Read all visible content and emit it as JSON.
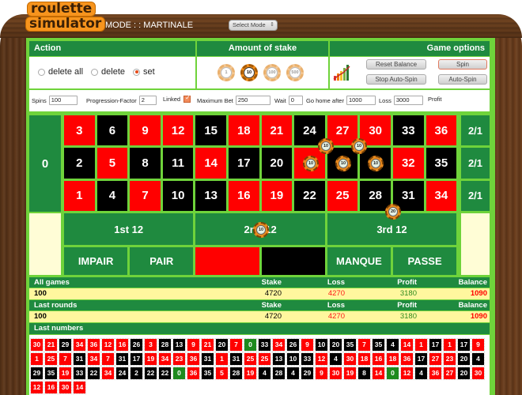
{
  "app": {
    "logo_line1": "roulette",
    "logo_line2": "simulator",
    "mode_label": "MODE : : MARTINALE",
    "mode_select": "Select Mode"
  },
  "action": {
    "header": "Action",
    "options": [
      {
        "label": "delete all",
        "selected": false
      },
      {
        "label": "delete",
        "selected": false
      },
      {
        "label": "set",
        "selected": true
      }
    ]
  },
  "stake": {
    "header": "Amount of stake",
    "chips": [
      {
        "value": "1",
        "selected": false
      },
      {
        "value": "10",
        "selected": true
      },
      {
        "value": "100",
        "selected": false
      },
      {
        "value": "500",
        "selected": false
      }
    ]
  },
  "game_options": {
    "header": "Game options",
    "icon": "growth-chart-icon",
    "buttons": {
      "reset_balance": "Reset Balance",
      "spin": "Spin",
      "stop_auto_spin": "Stop Auto-Spin",
      "auto_spin": "Auto-Spin"
    }
  },
  "params": {
    "spins_label": "Spins",
    "spins_value": "100",
    "factor_label": "Progression-Factor",
    "factor_value": "2",
    "linked_label": "Linked",
    "linked_checked": true,
    "maxbet_label": "Maximum Bet",
    "maxbet_value": "250",
    "wait_label": "Wait",
    "wait_value": "0",
    "gohome_label": "Go home after",
    "gohome_value": "1000",
    "loss_label": "Loss",
    "loss_value": "3000",
    "profit_label": "Profit"
  },
  "table": {
    "zero": "0",
    "rows": [
      [
        {
          "n": "3",
          "c": "red"
        },
        {
          "n": "6",
          "c": "black"
        },
        {
          "n": "9",
          "c": "red"
        },
        {
          "n": "12",
          "c": "red"
        },
        {
          "n": "15",
          "c": "black"
        },
        {
          "n": "18",
          "c": "red"
        },
        {
          "n": "21",
          "c": "red"
        },
        {
          "n": "24",
          "c": "black"
        },
        {
          "n": "27",
          "c": "red"
        },
        {
          "n": "30",
          "c": "red"
        },
        {
          "n": "33",
          "c": "black"
        },
        {
          "n": "36",
          "c": "red"
        }
      ],
      [
        {
          "n": "2",
          "c": "black"
        },
        {
          "n": "5",
          "c": "red"
        },
        {
          "n": "8",
          "c": "black"
        },
        {
          "n": "11",
          "c": "black"
        },
        {
          "n": "14",
          "c": "red"
        },
        {
          "n": "17",
          "c": "black"
        },
        {
          "n": "20",
          "c": "black"
        },
        {
          "n": "23",
          "c": "red"
        },
        {
          "n": "26",
          "c": "black"
        },
        {
          "n": "29",
          "c": "black"
        },
        {
          "n": "32",
          "c": "red"
        },
        {
          "n": "35",
          "c": "black"
        }
      ],
      [
        {
          "n": "1",
          "c": "red"
        },
        {
          "n": "4",
          "c": "black"
        },
        {
          "n": "7",
          "c": "red"
        },
        {
          "n": "10",
          "c": "black"
        },
        {
          "n": "13",
          "c": "black"
        },
        {
          "n": "16",
          "c": "red"
        },
        {
          "n": "19",
          "c": "red"
        },
        {
          "n": "22",
          "c": "black"
        },
        {
          "n": "25",
          "c": "red"
        },
        {
          "n": "28",
          "c": "black"
        },
        {
          "n": "31",
          "c": "black"
        },
        {
          "n": "34",
          "c": "red"
        }
      ]
    ],
    "columns": [
      "2/1",
      "2/1",
      "2/1"
    ],
    "dozens": [
      "1st 12",
      "2nd 12",
      "3rd 12"
    ],
    "even_money": [
      "IMPAIR",
      "PAIR",
      "",
      "",
      "MANQUE",
      "PASSE"
    ],
    "even_money_colors": [
      "green",
      "green",
      "red",
      "black",
      "green",
      "green"
    ],
    "bets": [
      {
        "value": "10",
        "spot": "corner 23-24-26-27"
      },
      {
        "value": "10",
        "spot": "corner 26-27-29-30"
      },
      {
        "value": "10",
        "spot": "23"
      },
      {
        "value": "10",
        "spot": "26"
      },
      {
        "value": "10",
        "spot": "29"
      },
      {
        "value": "20",
        "spot": "split 28-31 street"
      },
      {
        "value": "10",
        "spot": "2nd 12"
      }
    ]
  },
  "stats": {
    "all_games": {
      "title": "All games",
      "stake_h": "Stake",
      "loss_h": "Loss",
      "profit_h": "Profit",
      "balance_h": "Balance",
      "rounds": "100",
      "stake": "4720",
      "loss": "4270",
      "profit": "3180",
      "balance": "1090"
    },
    "last_rounds": {
      "title": "Last rounds",
      "stake_h": "Stake",
      "loss_h": "Loss",
      "profit_h": "Profit",
      "balance_h": "Balance",
      "rounds": "100",
      "stake": "4720",
      "loss": "4270",
      "profit": "3180",
      "balance": "1090"
    }
  },
  "last_numbers": {
    "title": "Last numbers",
    "rows": [
      [
        "30",
        "21",
        "29",
        "34",
        "36",
        "12",
        "16",
        "26",
        "3",
        "28",
        "13",
        "9",
        "21",
        "20",
        "7",
        "0",
        "33",
        "34",
        "26",
        "9",
        "10",
        "20",
        "35",
        "7",
        "35",
        "4",
        "14",
        "1",
        "17",
        "1",
        "17",
        "9"
      ],
      [
        "1",
        "25",
        "7",
        "31",
        "34",
        "7",
        "31",
        "17",
        "19",
        "34",
        "23",
        "36",
        "31",
        "1",
        "31",
        "25",
        "25",
        "13",
        "10",
        "33",
        "12",
        "4",
        "30",
        "18",
        "16",
        "18",
        "36",
        "17",
        "27",
        "23",
        "20",
        "4"
      ],
      [
        "29",
        "35",
        "19",
        "33",
        "22",
        "34",
        "24",
        "2",
        "22",
        "22",
        "0",
        "36",
        "35",
        "5",
        "28",
        "19",
        "4",
        "28",
        "4",
        "29",
        "9",
        "30",
        "19",
        "8",
        "14",
        "0",
        "12",
        "4",
        "36",
        "27",
        "20",
        "30"
      ],
      [
        "12",
        "16",
        "30",
        "14"
      ]
    ]
  }
}
